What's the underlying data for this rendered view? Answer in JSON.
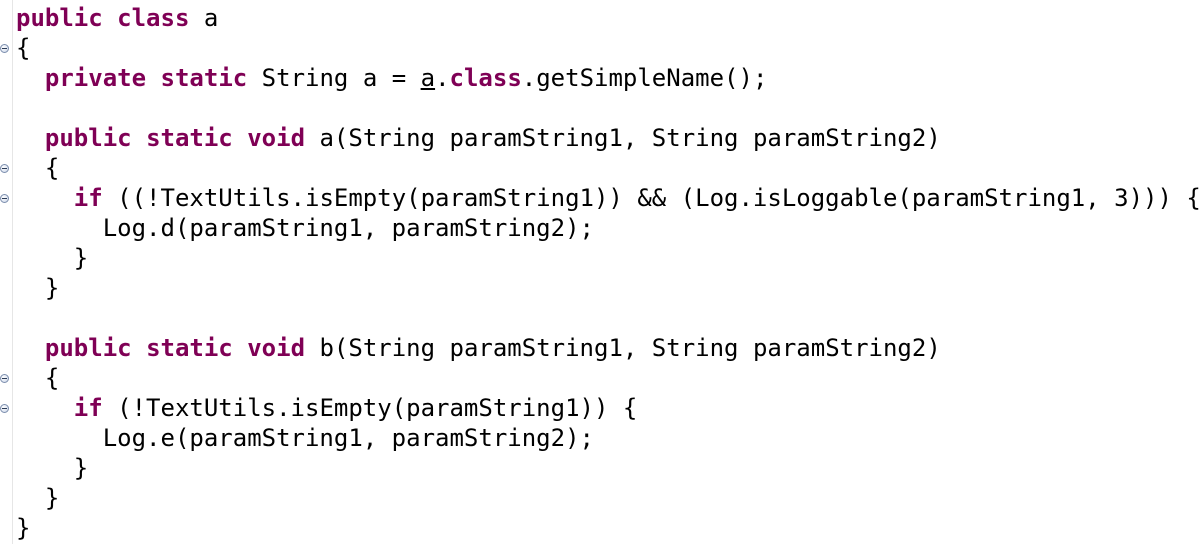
{
  "editor": {
    "colors": {
      "background": "#ffffff",
      "keyword": "#7f0055",
      "text": "#000000",
      "fold_marker": "#7d8fae"
    },
    "fold_icon": "collapse-minus-icon",
    "lines": [
      [
        {
          "t": "public",
          "k": true
        },
        {
          "t": " "
        },
        {
          "t": "class",
          "k": true
        },
        {
          "t": " a"
        }
      ],
      [
        {
          "t": "{"
        }
      ],
      [
        {
          "t": "  "
        },
        {
          "t": "private",
          "k": true
        },
        {
          "t": " "
        },
        {
          "t": "static",
          "k": true
        },
        {
          "t": " String a = "
        },
        {
          "t": "a",
          "u": true
        },
        {
          "t": "."
        },
        {
          "t": "class",
          "k": true
        },
        {
          "t": ".getSimpleName();"
        }
      ],
      [],
      [
        {
          "t": "  "
        },
        {
          "t": "public",
          "k": true
        },
        {
          "t": " "
        },
        {
          "t": "static",
          "k": true
        },
        {
          "t": " "
        },
        {
          "t": "void",
          "k": true
        },
        {
          "t": " a(String paramString1, String paramString2)"
        }
      ],
      [
        {
          "t": "  {"
        }
      ],
      [
        {
          "t": "    "
        },
        {
          "t": "if",
          "k": true
        },
        {
          "t": " ((!TextUtils.isEmpty(paramString1)) && (Log.isLoggable(paramString1, 3))) {"
        }
      ],
      [
        {
          "t": "      Log.d(paramString1, paramString2);"
        }
      ],
      [
        {
          "t": "    }"
        }
      ],
      [
        {
          "t": "  }"
        }
      ],
      [],
      [
        {
          "t": "  "
        },
        {
          "t": "public",
          "k": true
        },
        {
          "t": " "
        },
        {
          "t": "static",
          "k": true
        },
        {
          "t": " "
        },
        {
          "t": "void",
          "k": true
        },
        {
          "t": " b(String paramString1, String paramString2)"
        }
      ],
      [
        {
          "t": "  {"
        }
      ],
      [
        {
          "t": "    "
        },
        {
          "t": "if",
          "k": true
        },
        {
          "t": " (!TextUtils.isEmpty(paramString1)) {"
        }
      ],
      [
        {
          "t": "      Log.e(paramString1, paramString2);"
        }
      ],
      [
        {
          "t": "    }"
        }
      ],
      [
        {
          "t": "  }"
        }
      ],
      [
        {
          "t": "}"
        }
      ]
    ],
    "fold_lines": [
      1,
      5,
      6,
      12,
      13
    ]
  }
}
